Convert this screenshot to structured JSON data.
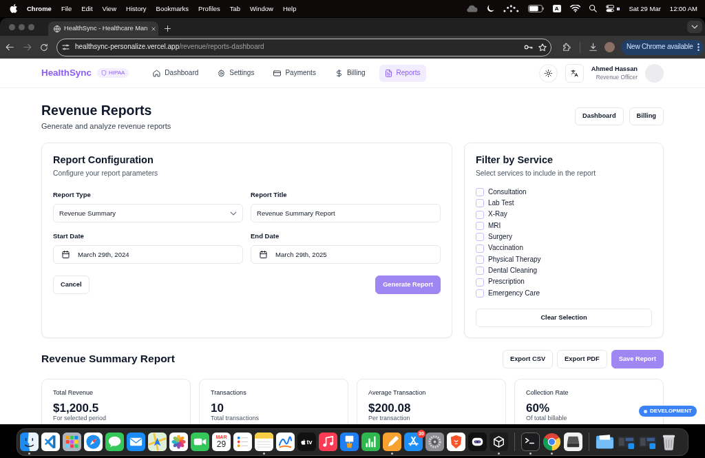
{
  "menu_bar": {
    "app": "Chrome",
    "menus": [
      "File",
      "Edit",
      "View",
      "History",
      "Bookmarks",
      "Profiles",
      "Tab",
      "Window",
      "Help"
    ],
    "input_source": "A",
    "date": "Sat 29 Mar",
    "time": "12:00 AM"
  },
  "browser": {
    "tab": {
      "title": "HealthSync - Healthcare Man",
      "selected": true
    },
    "url": {
      "host": "healthsync-personalize.vercel.app",
      "path": "/revenue/reports-dashboard"
    },
    "update_button": "New Chrome available"
  },
  "app_header": {
    "brand": "HealthSync",
    "badge": "HIPAA",
    "nav": [
      {
        "label": "Dashboard",
        "selected": false
      },
      {
        "label": "Settings",
        "selected": false
      },
      {
        "label": "Payments",
        "selected": false
      },
      {
        "label": "Billing",
        "selected": false
      },
      {
        "label": "Reports",
        "selected": true
      }
    ],
    "user": {
      "name": "Ahmed Hassan",
      "role": "Revenue Officer"
    }
  },
  "page_header": {
    "title": "Revenue Reports",
    "subtitle": "Generate and analyze revenue reports",
    "buttons": [
      "Dashboard",
      "Billing"
    ]
  },
  "report_configuration": {
    "title": "Report Configuration",
    "subtitle": "Configure your report parameters",
    "fields": [
      {
        "label": "Report Type",
        "kind": "select",
        "value": "Revenue Summary"
      },
      {
        "label": "Report Title",
        "kind": "text",
        "value": "Revenue Summary Report"
      },
      {
        "label": "Start Date",
        "kind": "date",
        "value": "March 29th, 2024"
      },
      {
        "label": "End Date",
        "kind": "date",
        "value": "March 29th, 2025"
      }
    ],
    "cancel_button": "Cancel",
    "submit_button": "Generate Report"
  },
  "service_filter": {
    "title": "Filter by Service",
    "subtitle": "Select services to include in the report",
    "services": [
      {
        "label": "Consultation",
        "checked": false
      },
      {
        "label": "Lab Test",
        "checked": false
      },
      {
        "label": "X-Ray",
        "checked": false
      },
      {
        "label": "MRI",
        "checked": false
      },
      {
        "label": "Surgery",
        "checked": false
      },
      {
        "label": "Vaccination",
        "checked": false
      },
      {
        "label": "Physical Therapy",
        "checked": false
      },
      {
        "label": "Dental Cleaning",
        "checked": false
      },
      {
        "label": "Prescription",
        "checked": false
      },
      {
        "label": "Emergency Care",
        "checked": false
      }
    ],
    "clear_button": "Clear Selection"
  },
  "summary": {
    "title": "Revenue Summary Report",
    "buttons": [
      {
        "label": "Export CSV",
        "kind": "outline"
      },
      {
        "label": "Export PDF",
        "kind": "outline"
      },
      {
        "label": "Save Report",
        "kind": "primary"
      }
    ],
    "stats": [
      {
        "label": "Total Revenue",
        "value": "$1,200.5",
        "note": "For selected period"
      },
      {
        "label": "Transactions",
        "value": "10",
        "note": "Total transactions"
      },
      {
        "label": "Average Transaction",
        "value": "$200.08",
        "note": "Per transaction"
      },
      {
        "label": "Collection Rate",
        "value": "60%",
        "note": "Of total billable"
      }
    ]
  },
  "environment_badge": "DEVELOPMENT",
  "dock": [
    {
      "kind": "face",
      "running": true
    },
    {
      "kind": "bracket",
      "running": false
    },
    {
      "kind": "grid",
      "running": false
    },
    {
      "kind": "compass",
      "running": false
    },
    {
      "kind": "bubble",
      "running": false
    },
    {
      "kind": "envelope",
      "running": false
    },
    {
      "kind": "map",
      "running": false
    },
    {
      "kind": "flower",
      "running": false
    },
    {
      "kind": "camera",
      "running": false
    },
    {
      "kind": "calendar",
      "month": "MAR",
      "day": "29",
      "running": false
    },
    {
      "kind": "checklist",
      "running": false
    },
    {
      "kind": "notepad",
      "running": true
    },
    {
      "kind": "scribble",
      "running": false
    },
    {
      "kind": "tv",
      "label": "tv",
      "running": false
    },
    {
      "kind": "note",
      "running": false
    },
    {
      "kind": "podium",
      "running": false
    },
    {
      "kind": "bars",
      "running": false
    },
    {
      "kind": "pen",
      "running": true
    },
    {
      "kind": "store",
      "badge": "30",
      "running": false
    },
    {
      "kind": "gear",
      "running": false
    },
    {
      "kind": "shield",
      "running": false
    },
    {
      "kind": "robot",
      "running": false
    },
    {
      "kind": "cube",
      "running": true
    },
    {
      "kind": "divider"
    },
    {
      "kind": "terminal",
      "running": true
    },
    {
      "kind": "ring",
      "running": true
    },
    {
      "kind": "scanner",
      "running": false
    },
    {
      "kind": "divider"
    },
    {
      "kind": "folder",
      "running": false
    },
    {
      "kind": "thumbnail",
      "running": false
    },
    {
      "kind": "thumbnail",
      "running": false
    },
    {
      "kind": "trash",
      "running": false
    }
  ]
}
